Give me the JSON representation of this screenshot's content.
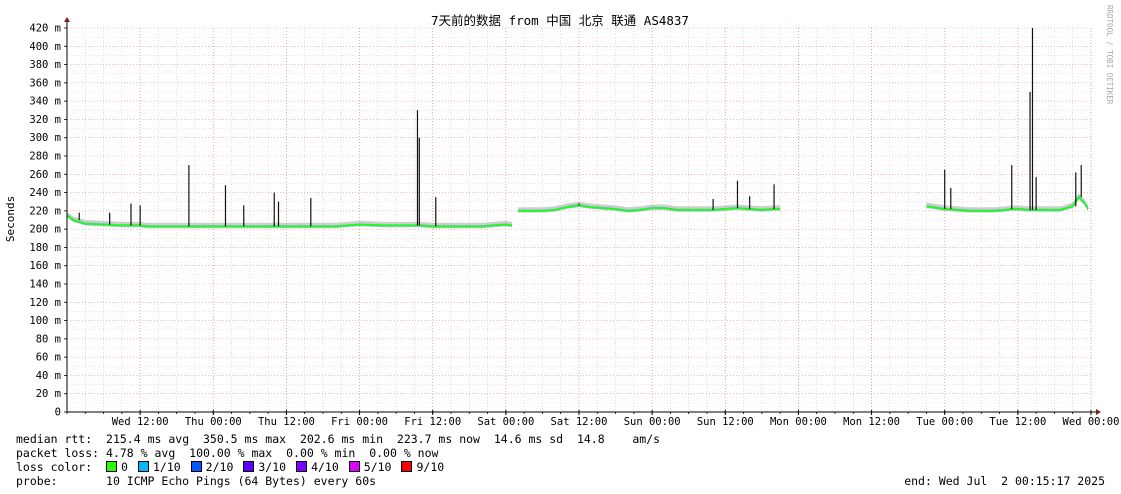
{
  "chart_data": {
    "type": "line",
    "title": "7天前的数据 from 中国 北京 联通 AS4837",
    "ylabel": "Seconds",
    "watermark": "RRDTOOL / TOBI OETIKER",
    "ylim": [
      0,
      420
    ],
    "yticks": [
      {
        "v": 0,
        "label": "0"
      },
      {
        "v": 20,
        "label": "20 m"
      },
      {
        "v": 40,
        "label": "40 m"
      },
      {
        "v": 60,
        "label": "60 m"
      },
      {
        "v": 80,
        "label": "80 m"
      },
      {
        "v": 100,
        "label": "100 m"
      },
      {
        "v": 120,
        "label": "120 m"
      },
      {
        "v": 140,
        "label": "140 m"
      },
      {
        "v": 160,
        "label": "160 m"
      },
      {
        "v": 180,
        "label": "180 m"
      },
      {
        "v": 200,
        "label": "200 m"
      },
      {
        "v": 220,
        "label": "220 m"
      },
      {
        "v": 240,
        "label": "240 m"
      },
      {
        "v": 260,
        "label": "260 m"
      },
      {
        "v": 280,
        "label": "280 m"
      },
      {
        "v": 300,
        "label": "300 m"
      },
      {
        "v": 320,
        "label": "320 m"
      },
      {
        "v": 340,
        "label": "340 m"
      },
      {
        "v": 360,
        "label": "360 m"
      },
      {
        "v": 380,
        "label": "380 m"
      },
      {
        "v": 400,
        "label": "400 m"
      },
      {
        "v": 420,
        "label": "420 m"
      }
    ],
    "xlim": [
      0,
      168
    ],
    "xticks": [
      {
        "t": 12,
        "label": "Wed 12:00"
      },
      {
        "t": 24,
        "label": "Thu 00:00"
      },
      {
        "t": 36,
        "label": "Thu 12:00"
      },
      {
        "t": 48,
        "label": "Fri 00:00"
      },
      {
        "t": 60,
        "label": "Fri 12:00"
      },
      {
        "t": 72,
        "label": "Sat 00:00"
      },
      {
        "t": 84,
        "label": "Sat 12:00"
      },
      {
        "t": 96,
        "label": "Sun 00:00"
      },
      {
        "t": 108,
        "label": "Sun 12:00"
      },
      {
        "t": 120,
        "label": "Mon 00:00"
      },
      {
        "t": 132,
        "label": "Mon 12:00"
      },
      {
        "t": 144,
        "label": "Tue 00:00"
      },
      {
        "t": 156,
        "label": "Tue 12:00"
      },
      {
        "t": 168,
        "label": "Wed 00:00"
      }
    ],
    "series": [
      {
        "name": "median rtt",
        "segments": [
          [
            [
              0,
              215
            ],
            [
              1,
              210
            ],
            [
              3,
              206
            ],
            [
              6,
              205
            ],
            [
              9,
              204
            ],
            [
              12,
              204
            ],
            [
              13,
              203
            ],
            [
              16,
              203
            ],
            [
              20,
              203
            ],
            [
              24,
              203
            ],
            [
              28,
              203
            ],
            [
              32,
              203
            ],
            [
              36,
              203
            ],
            [
              40,
              203
            ],
            [
              44,
              203
            ],
            [
              48,
              205
            ],
            [
              52,
              204
            ],
            [
              56,
              204
            ],
            [
              58,
              204
            ],
            [
              60,
              203
            ],
            [
              64,
              203
            ],
            [
              68,
              203
            ],
            [
              70,
              204
            ],
            [
              72,
              205
            ],
            [
              73,
              204
            ]
          ],
          [
            [
              74,
              220
            ],
            [
              76,
              220
            ],
            [
              78,
              220
            ],
            [
              80,
              221
            ],
            [
              82,
              224
            ],
            [
              84,
              226
            ],
            [
              86,
              224
            ],
            [
              88,
              223
            ],
            [
              90,
              222
            ],
            [
              92,
              220
            ],
            [
              94,
              221
            ],
            [
              96,
              223
            ],
            [
              98,
              223
            ],
            [
              100,
              221
            ],
            [
              104,
              221
            ],
            [
              106,
              221
            ],
            [
              108,
              222
            ],
            [
              110,
              223
            ],
            [
              112,
              222
            ],
            [
              114,
              221
            ],
            [
              116,
              222
            ],
            [
              117,
              222
            ]
          ],
          [
            [
              141,
              225
            ],
            [
              142,
              224
            ],
            [
              144,
              222
            ],
            [
              146,
              221
            ],
            [
              148,
              220
            ],
            [
              152,
              220
            ],
            [
              154,
              221
            ],
            [
              155,
              222
            ],
            [
              156,
              222
            ],
            [
              158,
              221
            ],
            [
              160,
              221
            ],
            [
              163,
              221
            ],
            [
              165,
              225
            ],
            [
              166,
              235
            ],
            [
              167,
              228
            ],
            [
              167.5,
              222
            ]
          ]
        ],
        "spikes": [
          {
            "t": 2,
            "v": 218
          },
          {
            "t": 7,
            "v": 218
          },
          {
            "t": 10.5,
            "v": 228
          },
          {
            "t": 12,
            "v": 226
          },
          {
            "t": 20,
            "v": 270
          },
          {
            "t": 26,
            "v": 248
          },
          {
            "t": 29,
            "v": 226
          },
          {
            "t": 34,
            "v": 240
          },
          {
            "t": 34.7,
            "v": 230
          },
          {
            "t": 40,
            "v": 234
          },
          {
            "t": 57.5,
            "v": 330
          },
          {
            "t": 57.8,
            "v": 300
          },
          {
            "t": 60.5,
            "v": 235
          },
          {
            "t": 84,
            "v": 228
          },
          {
            "t": 106,
            "v": 233
          },
          {
            "t": 110,
            "v": 253
          },
          {
            "t": 112,
            "v": 236
          },
          {
            "t": 116,
            "v": 249
          },
          {
            "t": 144,
            "v": 265
          },
          {
            "t": 145,
            "v": 245
          },
          {
            "t": 155,
            "v": 270
          },
          {
            "t": 158,
            "v": 350
          },
          {
            "t": 158.4,
            "v": 420
          },
          {
            "t": 159,
            "v": 257
          },
          {
            "t": 165.5,
            "v": 262
          },
          {
            "t": 166.4,
            "v": 270
          }
        ]
      }
    ],
    "gaps": [
      [
        73.2,
        73.8
      ],
      [
        117.2,
        140.8
      ]
    ]
  },
  "legend": {
    "median": {
      "label": "median rtt:",
      "avg": "215.4 ms avg",
      "max": "350.5 ms max",
      "min": "202.6 ms min",
      "now": "223.7 ms now",
      "sd": "14.6 ms sd",
      "am": "14.8",
      "am_unit": "am/s"
    },
    "loss": {
      "label": "packet loss:",
      "avg": "4.78 % avg",
      "max": "100.00 % max",
      "min": "0.00 % min",
      "now": "0.00 % now"
    },
    "loss_color_label": "loss color:",
    "loss_colors": [
      {
        "label": "0",
        "color": "#26ff00"
      },
      {
        "label": "1/10",
        "color": "#00b8ff"
      },
      {
        "label": "2/10",
        "color": "#0059ff"
      },
      {
        "label": "3/10",
        "color": "#5e00ff"
      },
      {
        "label": "4/10",
        "color": "#7e00ff"
      },
      {
        "label": "5/10",
        "color": "#dd00ff"
      },
      {
        "label": "9/10",
        "color": "#ff0000"
      }
    ],
    "probe_label": "probe:",
    "probe_value": "10 ICMP Echo Pings (64 Bytes) every 60s",
    "end_text": "end: Wed Jul  2 00:15:17 2025"
  }
}
